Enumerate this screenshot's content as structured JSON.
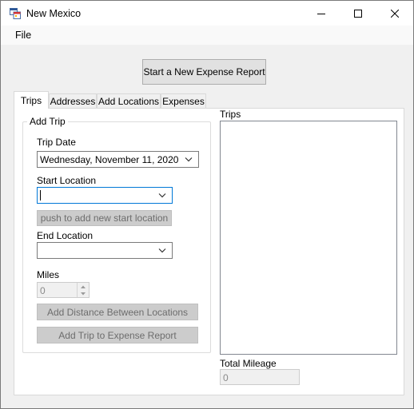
{
  "window": {
    "title": "New Mexico",
    "icon": "app-window-icon",
    "controls": [
      "minimize-icon",
      "maximize-icon",
      "close-icon"
    ]
  },
  "menu": {
    "file": "File"
  },
  "toolbar": {
    "new_report": "Start a New Expense Report"
  },
  "tabs": [
    {
      "label": "Trips",
      "active": true
    },
    {
      "label": "Addresses",
      "active": false
    },
    {
      "label": "Add Locations",
      "active": false
    },
    {
      "label": "Expenses",
      "active": false
    }
  ],
  "add_trip": {
    "title": "Add Trip",
    "trip_date_label": "Trip Date",
    "trip_date_value": "Wednesday,  November  11, 2020",
    "start_location_label": "Start Location",
    "start_location_value": "",
    "push_start_button": "push to add new start location",
    "end_location_label": "End Location",
    "end_location_value": "",
    "miles_label": "Miles",
    "miles_value": "0",
    "add_distance_button": "Add Distance Between Locations",
    "add_trip_button": "Add Trip to Expense Report"
  },
  "trips_panel": {
    "label": "Trips",
    "items": [],
    "total_mileage_label": "Total Mileage",
    "total_mileage_value": "0"
  }
}
